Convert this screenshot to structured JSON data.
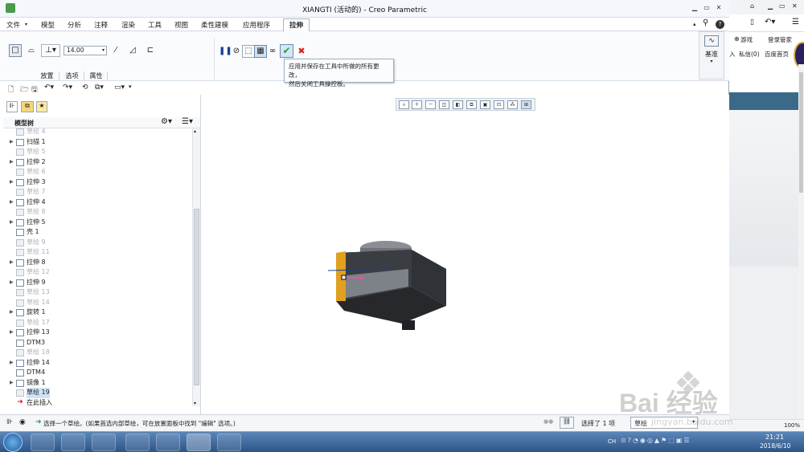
{
  "app": {
    "title": "XIANGTI (活动的) - Creo Parametric"
  },
  "menus": [
    {
      "label": "文件"
    },
    {
      "label": "模型"
    },
    {
      "label": "分析"
    },
    {
      "label": "注释"
    },
    {
      "label": "渲染"
    },
    {
      "label": "工具"
    },
    {
      "label": "视图"
    },
    {
      "label": "柔性建模"
    },
    {
      "label": "应用程序"
    },
    {
      "label": "拉伸"
    }
  ],
  "ribbon": {
    "depth_value": "14.00",
    "tabs": [
      {
        "label": "放置"
      },
      {
        "label": "选项"
      },
      {
        "label": "属性"
      }
    ],
    "datum_label": "基准"
  },
  "tooltip": {
    "line1": "应用并保存在工具中所做的所有更改，",
    "line2": "然后关闭工具操控板。"
  },
  "panel": {
    "header": "模型树"
  },
  "tree": [
    {
      "label": "草绘 4",
      "state": "dim"
    },
    {
      "label": "扫描 1",
      "state": "normal",
      "expand": true
    },
    {
      "label": "草绘 5",
      "state": "dim"
    },
    {
      "label": "拉伸 2",
      "state": "normal",
      "expand": true
    },
    {
      "label": "草绘 6",
      "state": "dim"
    },
    {
      "label": "拉伸 3",
      "state": "normal",
      "expand": true
    },
    {
      "label": "草绘 7",
      "state": "dim"
    },
    {
      "label": "拉伸 4",
      "state": "normal",
      "expand": true
    },
    {
      "label": "草绘 8",
      "state": "dim"
    },
    {
      "label": "拉伸 5",
      "state": "normal",
      "expand": true
    },
    {
      "label": "壳 1",
      "state": "normal"
    },
    {
      "label": "草绘 9",
      "state": "dim"
    },
    {
      "label": "草绘 11",
      "state": "dim"
    },
    {
      "label": "拉伸 8",
      "state": "normal",
      "expand": true
    },
    {
      "label": "草绘 12",
      "state": "dim"
    },
    {
      "label": "拉伸 9",
      "state": "normal",
      "expand": true
    },
    {
      "label": "草绘 13",
      "state": "dim"
    },
    {
      "label": "草绘 14",
      "state": "dim"
    },
    {
      "label": "旋转 1",
      "state": "normal",
      "expand": true
    },
    {
      "label": "草绘 17",
      "state": "dim"
    },
    {
      "label": "拉伸 13",
      "state": "normal",
      "expand": true
    },
    {
      "label": "DTM3",
      "state": "normal"
    },
    {
      "label": "草绘 18",
      "state": "dim"
    },
    {
      "label": "拉伸 14",
      "state": "normal",
      "expand": true
    },
    {
      "label": "DTM4",
      "state": "normal"
    },
    {
      "label": "镜像 1",
      "state": "normal",
      "expand": true
    },
    {
      "label": "草绘 19",
      "state": "sel"
    },
    {
      "label": "在此插入",
      "state": "insert"
    }
  ],
  "status": {
    "message": "选择一个草绘。(如果首选内部草绘，可在放置面板中找到 \"编辑\" 选项。)",
    "selected": "选择了 1 项",
    "filter": "草绘"
  },
  "browser": {
    "nav1": "游戏",
    "nav2": "登录管家",
    "link1": "入",
    "link2": "私信(0)",
    "link3": "百度首页",
    "zoom": "100%"
  },
  "taskbar": {
    "time": "21:21",
    "date": "2018/6/10",
    "lang": "CH"
  },
  "watermark": {
    "text": "Bai 经验",
    "url": "jingyan.baidu.com"
  },
  "colors": {
    "accept": "#2d9b3a",
    "cancel": "#d62020",
    "model": "#3a3d42",
    "face": "#e0a020"
  }
}
